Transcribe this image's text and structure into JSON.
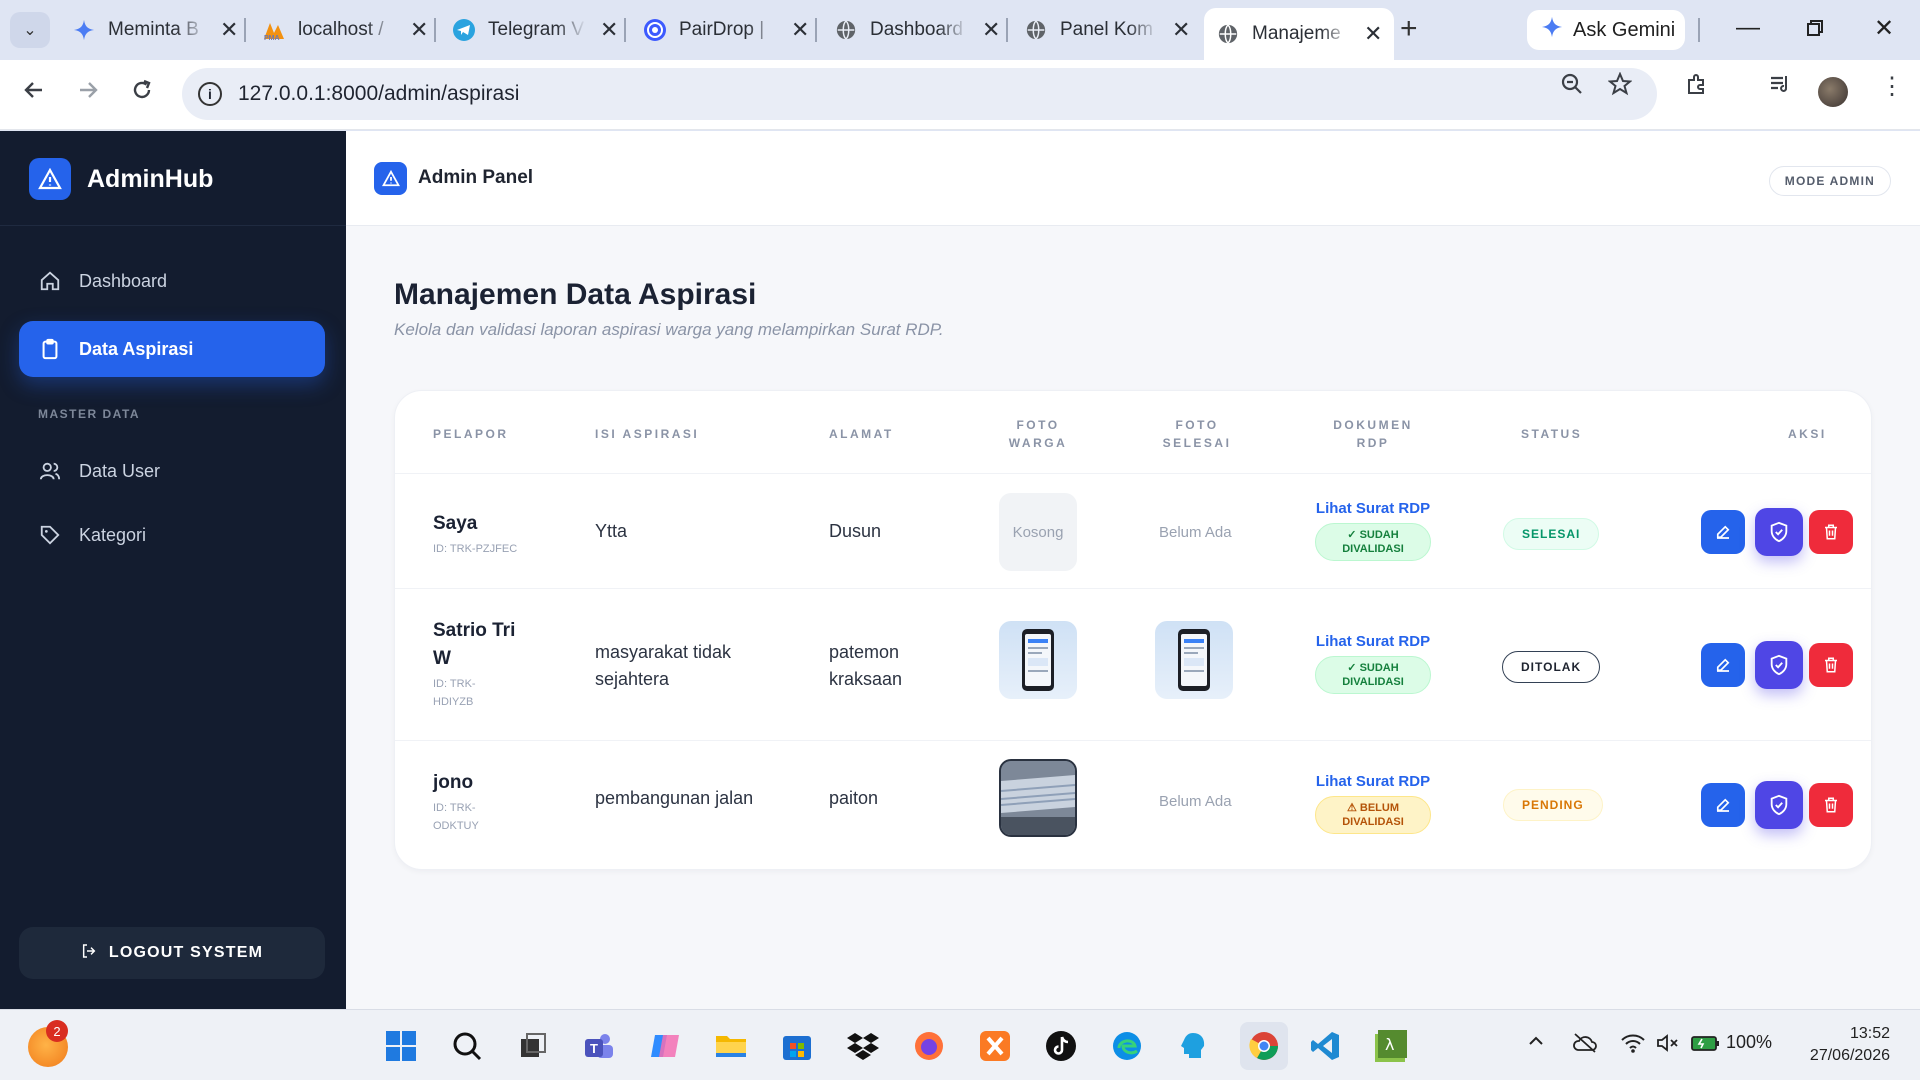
{
  "browser": {
    "tabs": [
      {
        "title": "Meminta B",
        "icon": "gemini-icon"
      },
      {
        "title": "localhost /",
        "icon": "phpmyadmin-icon"
      },
      {
        "title": "Telegram V",
        "icon": "telegram-icon"
      },
      {
        "title": "PairDrop |",
        "icon": "pairdrop-icon"
      },
      {
        "title": "Dashboard",
        "icon": "globe-icon"
      },
      {
        "title": "Panel Kom",
        "icon": "globe-icon"
      },
      {
        "title": "Manajeme",
        "icon": "globe-icon"
      }
    ],
    "new_tab": "+",
    "gemini_button": "Ask Gemini",
    "url": "127.0.0.1:8000/admin/aspirasi"
  },
  "sidebar": {
    "brand": "AdminHub",
    "items": [
      {
        "label": "Dashboard",
        "icon": "home-icon"
      },
      {
        "label": "Data Aspirasi",
        "icon": "clipboard-icon"
      }
    ],
    "section_label": "MASTER DATA",
    "master_items": [
      {
        "label": "Data User",
        "icon": "users-icon"
      },
      {
        "label": "Kategori",
        "icon": "tag-icon"
      }
    ],
    "logout": "LOGOUT SYSTEM"
  },
  "topbar": {
    "title": "Admin Panel",
    "mode_badge": "MODE ADMIN"
  },
  "page": {
    "title": "Manajemen Data Aspirasi",
    "subtitle": "Kelola dan validasi laporan aspirasi warga yang melampirkan Surat RDP."
  },
  "table": {
    "headers": {
      "pelapor": "PELAPOR",
      "isi": "ISI ASPIRASI",
      "alamat": "ALAMAT",
      "foto_warga_1": "FOTO",
      "foto_warga_2": "WARGA",
      "foto_selesai_1": "FOTO",
      "foto_selesai_2": "SELESAI",
      "dokumen_1": "DOKUMEN",
      "dokumen_2": "RDP",
      "status": "STATUS",
      "aksi": "AKSI"
    },
    "rows": [
      {
        "name": "Saya",
        "id": "ID: TRK-PZJFEC",
        "isi": "Ytta",
        "alamat": "Dusun",
        "foto_warga": "Kosong",
        "foto_selesai": "Belum Ada",
        "rdp_link": "Lihat Surat RDP",
        "rdp_status_1": "✓ SUDAH",
        "rdp_status_2": "DIVALIDASI",
        "status": "SELESAI"
      },
      {
        "name_1": "Satrio Tri",
        "name_2": "W",
        "id_1": "ID: TRK-",
        "id_2": "HDIYZB",
        "isi_1": "masyarakat tidak",
        "isi_2": "sejahtera",
        "alamat_1": "patemon",
        "alamat_2": "kraksaan",
        "rdp_link": "Lihat Surat RDP",
        "rdp_status_1": "✓ SUDAH",
        "rdp_status_2": "DIVALIDASI",
        "status": "DITOLAK"
      },
      {
        "name": "jono",
        "id_1": "ID: TRK-",
        "id_2": "ODKTUY",
        "isi": "pembangunan jalan",
        "alamat": "paiton",
        "foto_selesai": "Belum Ada",
        "rdp_link": "Lihat Surat RDP",
        "rdp_status_1": "⚠ BELUM",
        "rdp_status_2": "DIVALIDASI",
        "status": "PENDING"
      }
    ]
  },
  "taskbar": {
    "weather_badge": "2",
    "battery": "100%",
    "time": "13:52",
    "date": "27/06/2026"
  },
  "colors": {
    "accent": "#2563eb",
    "sidebar_bg": "#131c2f",
    "validate": "#4f46e5",
    "delete": "#ef2b3b"
  }
}
